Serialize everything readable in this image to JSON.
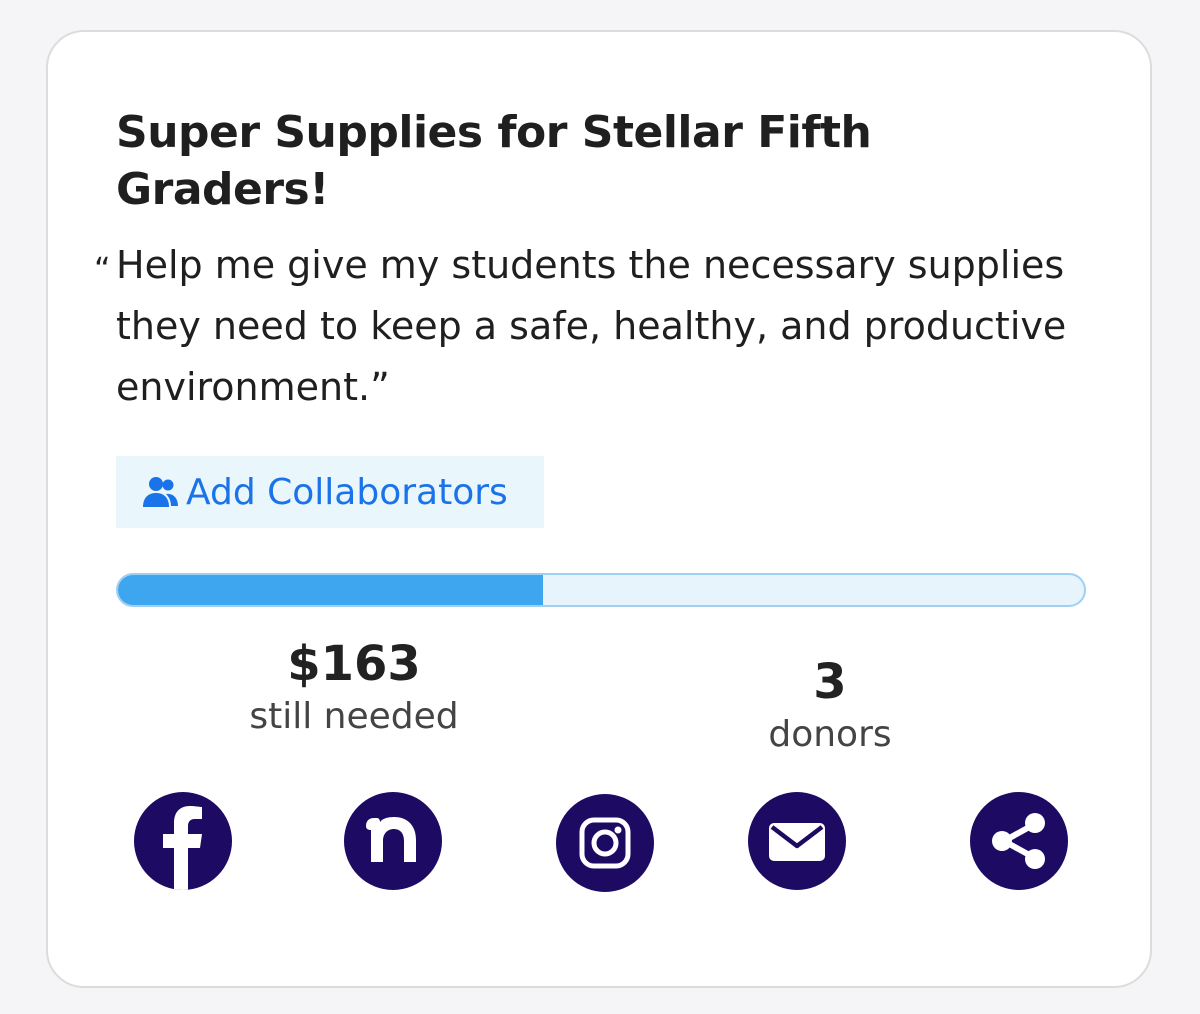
{
  "project": {
    "title": "Super Supplies for Stellar Fifth Graders!",
    "quote": "Help me give my students the necessary supplies they need to keep a safe, healthy, and productive environment.",
    "quote_open": "“",
    "quote_close": "”"
  },
  "collaborators": {
    "button_label": "Add Collaborators",
    "icon": "users-icon"
  },
  "progress": {
    "fraction_funded": 0.44
  },
  "stats": {
    "still_needed": {
      "value": "$163",
      "label": "still needed"
    },
    "donors": {
      "value": "3",
      "label": "donors"
    }
  },
  "share": {
    "icons": [
      "facebook-icon",
      "nextdoor-icon",
      "instagram-icon",
      "email-icon",
      "share-icon"
    ]
  },
  "colors": {
    "accent_blue": "#1a73e8",
    "progress_fill": "#3ea6ef",
    "progress_track": "#e8f4fc",
    "social_bg": "#1d0a63",
    "button_bg": "#e9f6fb"
  }
}
